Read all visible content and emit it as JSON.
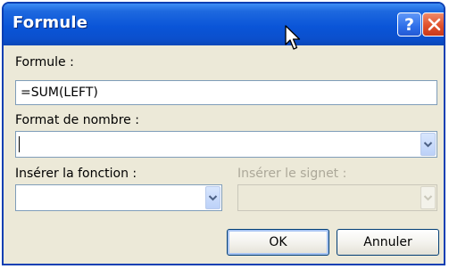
{
  "window": {
    "title": "Formule"
  },
  "formula": {
    "label": "Formule :",
    "value": "=SUM(LEFT)"
  },
  "number_format": {
    "label": "Format de nombre :",
    "value": ""
  },
  "insert_function": {
    "label": "Insérer la fonction :",
    "value": ""
  },
  "insert_bookmark": {
    "label": "Insérer le signet :",
    "value": ""
  },
  "buttons": {
    "ok": "OK",
    "cancel": "Annuler"
  },
  "icons": {
    "help": "help-icon",
    "close": "close-icon",
    "dropdown": "chevron-down-icon",
    "cursor": "mouse-pointer-icon"
  },
  "colors": {
    "title_bar": "#0a55d8",
    "dialog_bg": "#ece9d8",
    "close_button": "#e0512c",
    "disabled_text": "#aca899"
  }
}
